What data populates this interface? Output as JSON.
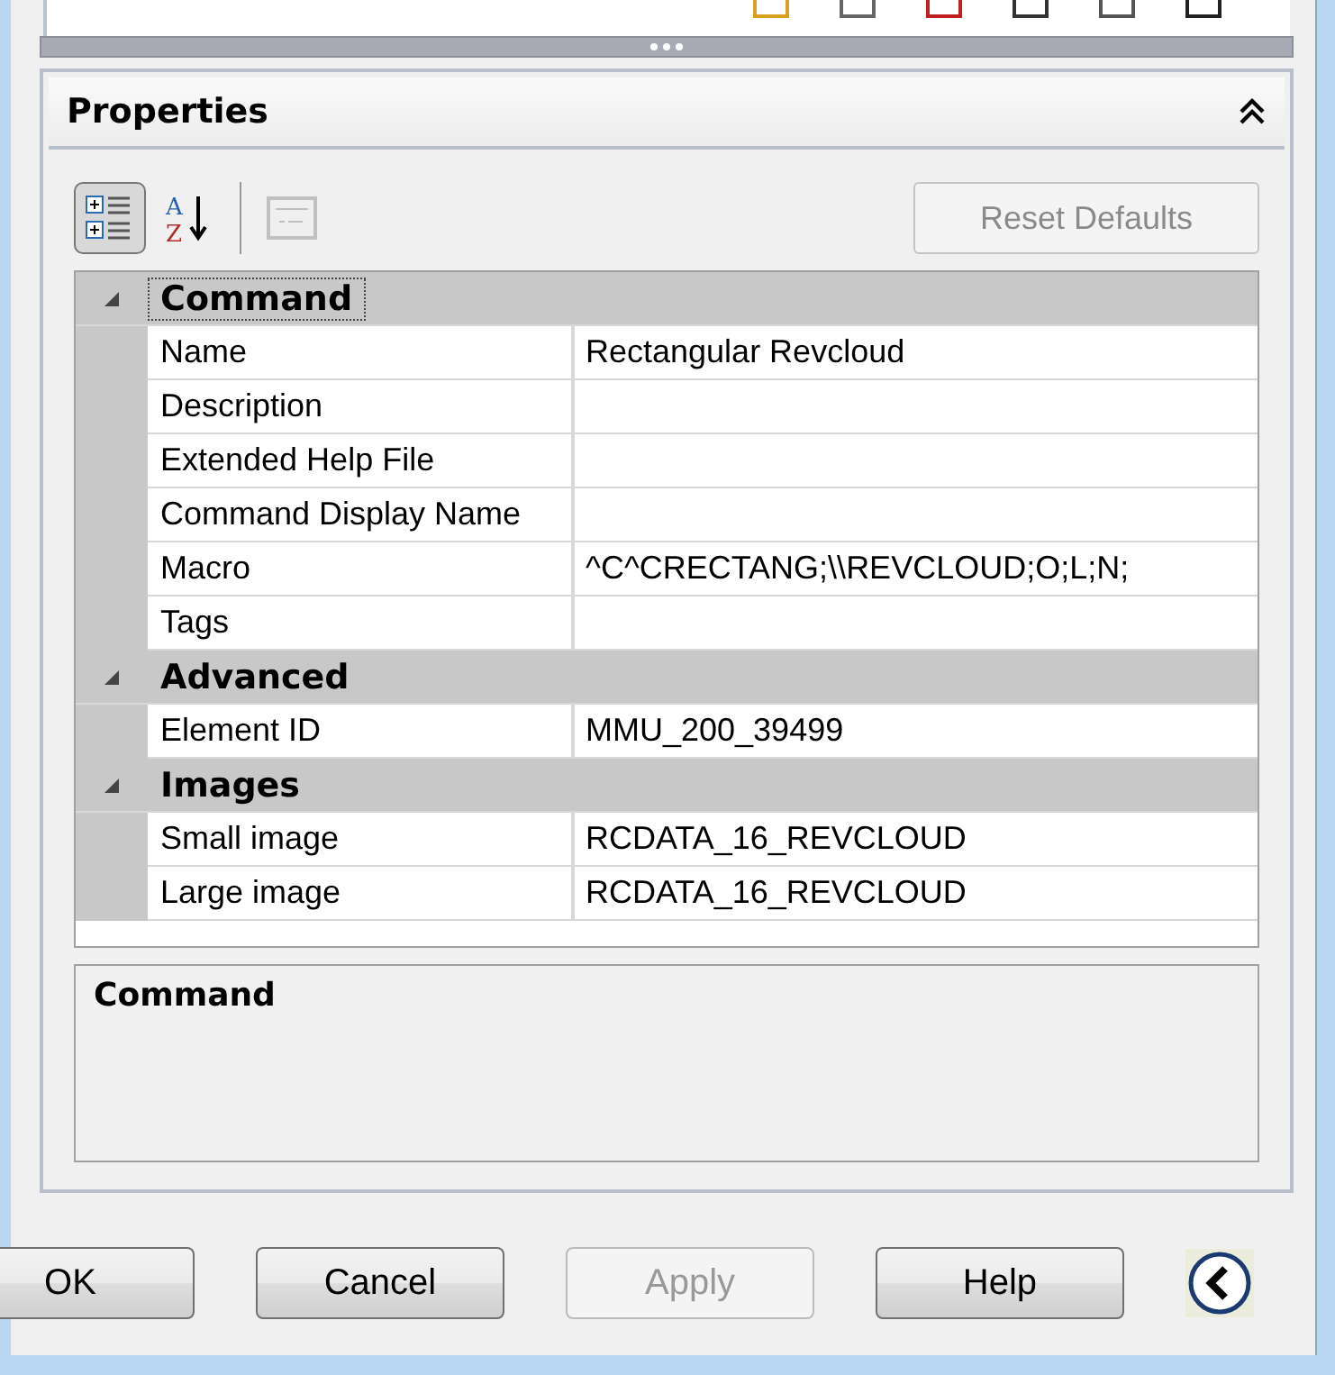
{
  "panel": {
    "title": "Properties",
    "expanded": true
  },
  "toolbar": {
    "sort_buttons": [
      {
        "kind": "categorized",
        "selected": true
      },
      {
        "kind": "alphabetical",
        "selected": false,
        "letters": [
          "A",
          "Z"
        ]
      }
    ],
    "pages_button": {
      "disabled": true
    },
    "reset": {
      "label": "Reset Defaults",
      "disabled": true
    }
  },
  "grid": {
    "categories": [
      {
        "name": "Command",
        "expanded": true,
        "focused": true,
        "rows": [
          {
            "name": "Name",
            "value": "Rectangular Revcloud"
          },
          {
            "name": "Description",
            "value": ""
          },
          {
            "name": "Extended Help File",
            "value": ""
          },
          {
            "name": "Command Display Name",
            "value": ""
          },
          {
            "name": "Macro",
            "value": "^C^CRECTANG;\\\\REVCLOUD;O;L;N;"
          },
          {
            "name": "Tags",
            "value": ""
          }
        ]
      },
      {
        "name": "Advanced",
        "expanded": true,
        "focused": false,
        "rows": [
          {
            "name": "Element ID",
            "value": "MMU_200_39499"
          }
        ]
      },
      {
        "name": "Images",
        "expanded": true,
        "focused": false,
        "rows": [
          {
            "name": "Small image",
            "value": "RCDATA_16_REVCLOUD"
          },
          {
            "name": "Large image",
            "value": "RCDATA_16_REVCLOUD"
          }
        ]
      }
    ]
  },
  "description": {
    "title": "Command"
  },
  "buttons": [
    {
      "label": "OK",
      "disabled": false
    },
    {
      "label": "Cancel",
      "disabled": false
    },
    {
      "label": "Apply",
      "disabled": true
    },
    {
      "label": "Help",
      "disabled": false
    }
  ]
}
